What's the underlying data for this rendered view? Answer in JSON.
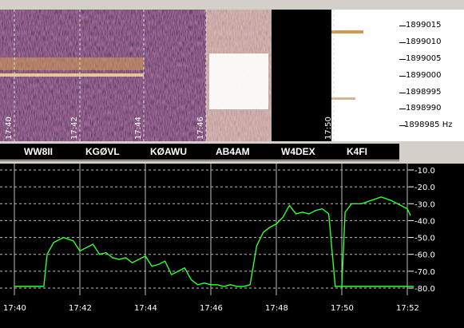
{
  "waterfall": {
    "time_labels": [
      "17:40",
      "17:42",
      "17:44",
      "17:46",
      "17:50"
    ],
    "freq_labels": [
      "1899015",
      "1899010",
      "1899005",
      "1899000",
      "1898995",
      "1898990",
      "1898985 Hz"
    ]
  },
  "callsigns": [
    "WW8II",
    "KGØVL",
    "KØAWU",
    "AB4AM",
    "W4DEX",
    "K4FI"
  ],
  "chart_data": {
    "type": "line",
    "x_ticks": [
      "17:40",
      "17:42",
      "17:44",
      "17:46",
      "17:48",
      "17:50",
      "17:52"
    ],
    "y_ticks": [
      "-10.0",
      "-20.0",
      "-30.0",
      "-40.0",
      "-50.0",
      "-60.0",
      "-70.0",
      "-80.0"
    ],
    "ylim": [
      -82,
      -8
    ],
    "xlim": [
      0,
      12.3
    ],
    "grid": true,
    "line_color": "#33ff33",
    "series": [
      {
        "x": [
          0,
          0.9,
          1.0,
          1.2,
          1.5,
          1.8,
          2.0,
          2.2,
          2.4,
          2.6,
          2.8,
          3.0,
          3.2,
          3.4,
          3.6,
          3.8,
          4.0,
          4.2,
          4.4,
          4.6,
          4.8,
          5.0,
          5.2,
          5.4,
          5.6,
          5.8,
          6.0,
          6.2,
          6.4,
          6.6,
          6.8,
          7.0,
          7.2,
          7.4,
          7.6,
          7.8,
          8.0,
          8.2,
          8.4,
          8.6,
          8.8,
          9.0,
          9.2,
          9.4,
          9.6,
          9.8,
          10.0,
          10.2,
          10.5,
          10.7,
          10.9,
          11.1,
          11.3,
          11.5,
          11.7,
          11.9,
          12.0,
          12.1,
          12.2
        ],
        "y": [
          -79,
          -79,
          -60,
          -53,
          -50,
          -52,
          -58,
          -56,
          -54,
          -60,
          -59,
          -62,
          -63,
          -62,
          -65,
          -63,
          -61,
          -67,
          -66,
          -64,
          -72,
          -70,
          -68,
          -75,
          -78,
          -77,
          -78,
          -78,
          -79,
          -78,
          -79,
          -79,
          -78,
          -55,
          -47,
          -44,
          -42,
          -38,
          -31,
          -36,
          -35,
          -36,
          -34,
          -33,
          -36,
          -79,
          -79,
          -79,
          -79,
          -79,
          -79,
          -79,
          -79,
          -79,
          -79,
          -79,
          -79,
          -79,
          -79
        ],
        "segment2": {
          "x": [
            10.0,
            10.1,
            10.3,
            10.6,
            10.9,
            11.2,
            11.5,
            11.8,
            12.0,
            12.1
          ],
          "y": [
            -79,
            -35,
            -30,
            -30,
            -28,
            -26,
            -28,
            -31,
            -33,
            -37
          ]
        }
      }
    ]
  }
}
